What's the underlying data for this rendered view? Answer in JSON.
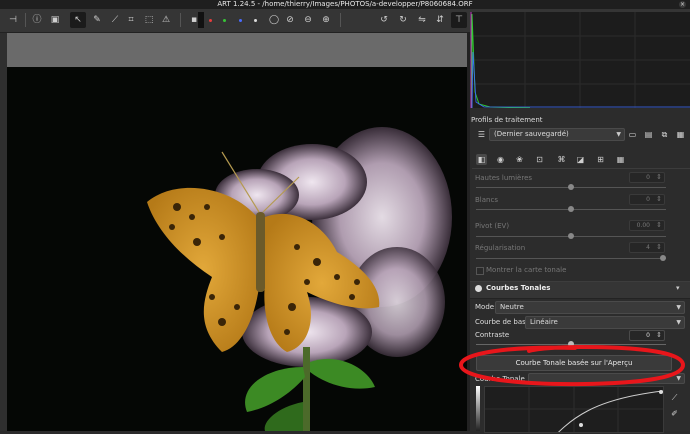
{
  "window": {
    "title": "ART 1.24.5 - /home/thierry/Images/PHOTOS/a-developper/P8060684.ORF",
    "close_symbol": "×"
  },
  "toolbar": {
    "icons": [
      "panel-toggle-icon",
      "info-icon",
      "history-icon",
      "copy-icon",
      "hand-icon",
      "color-picker-icon",
      "crop-icon",
      "straighten-icon",
      "perspective-icon",
      "clipping-indicator-icon",
      "focus-mask-icon",
      "preview-rgb-icon",
      "zoom-fit-icon",
      "zoom-100-icon",
      "zoom-out-icon",
      "zoom-in-icon",
      "rotate-left-icon",
      "rotate-right-icon",
      "flip-horizontal-icon",
      "flip-vertical-icon",
      "right-panel-toggle-icon"
    ],
    "preview_colors": [
      "#e63d3d",
      "#37c437",
      "#4a6cff",
      "#dddddd"
    ]
  },
  "processing_profiles": {
    "header": "Profils de traitement",
    "selected": "(Dernier sauvegardé)",
    "buttons": [
      "open-folder-icon",
      "save-icon",
      "copy-icon",
      "paste-icon"
    ]
  },
  "tool_tabs": [
    "exposure-tab-icon",
    "details-tab-icon",
    "color-tab-icon",
    "transform-tab-icon",
    "raw-tab-icon",
    "effects-tab-icon",
    "metadata-tab-icon"
  ],
  "tone_params": [
    {
      "label": "Hautes lumières",
      "value": "0"
    },
    {
      "label": "Blancs",
      "value": "0"
    },
    {
      "label": "Pivot (EV)",
      "value": "0.00"
    },
    {
      "label": "Régularisation",
      "value": "4"
    }
  ],
  "show_tone_map": "Montrer la carte tonale",
  "tone_curves": {
    "title": "Courbes Tonales",
    "mode_label": "Mode:",
    "mode_value": "Neutre",
    "base_curve_label": "Courbe de base:",
    "base_curve_value": "Linéaire",
    "contrast_label": "Contraste",
    "contrast_value": "0",
    "preview_button": "Courbe Tonale basée sur l'Aperçu",
    "curve_label": "Courbe Tonale"
  },
  "annotation": {
    "color": "#e8161b"
  }
}
